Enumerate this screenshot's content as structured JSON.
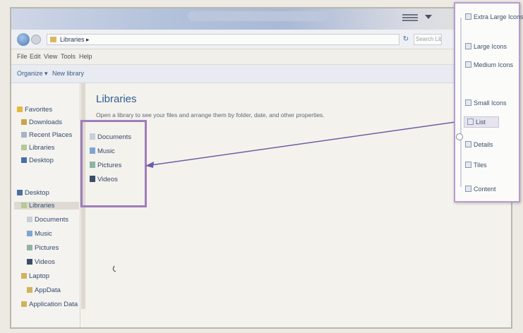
{
  "address": {
    "path": "Libraries",
    "search_placeholder": "Search Lib"
  },
  "menu": [
    "File",
    "Edit",
    "View",
    "Tools",
    "Help"
  ],
  "commands": {
    "organize": "Organize ▾",
    "new_library": "New library"
  },
  "nav": {
    "favorites_header": "Favorites",
    "favorites": [
      "Downloads",
      "Recent Places",
      "Libraries",
      "Desktop"
    ],
    "desktop_header": "Desktop",
    "tree": [
      "Libraries",
      "Documents",
      "Music",
      "Pictures",
      "Videos",
      "Laptop",
      "AppData",
      "Application Data"
    ]
  },
  "content": {
    "title": "Libraries",
    "subtitle": "Open a library to see your files and arrange them by folder, date, and other properties.",
    "items": [
      "Documents",
      "Music",
      "Pictures",
      "Videos"
    ]
  },
  "view_menu": {
    "options": [
      "Extra Large Icons",
      "Large Icons",
      "Medium Icons",
      "Small Icons",
      "List",
      "Details",
      "Tiles",
      "Content"
    ],
    "selected": "List"
  },
  "colors": {
    "accent": "#9f7dbb",
    "link": "#2e5d95"
  }
}
